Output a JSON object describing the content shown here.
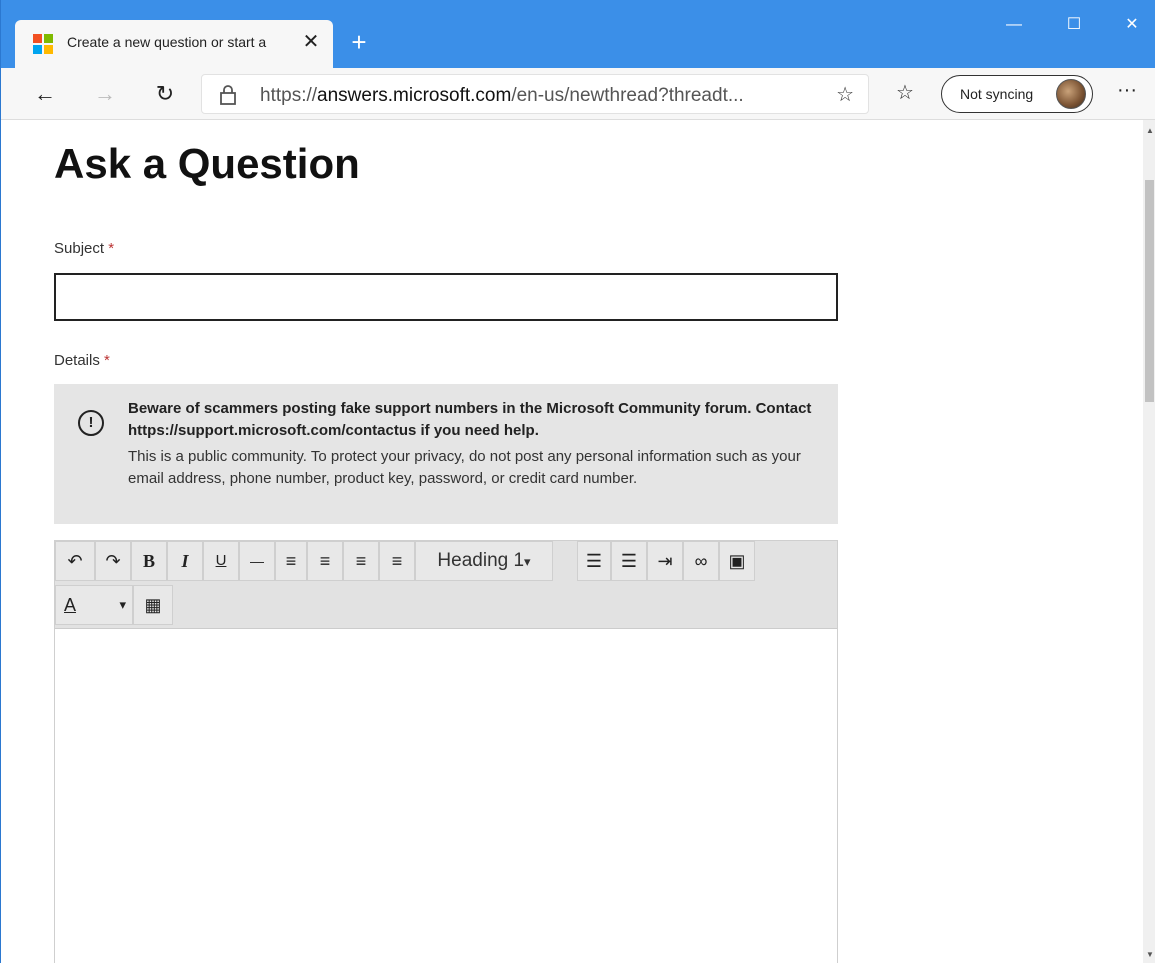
{
  "browser": {
    "tab_title": "Create a new question or start a",
    "tab_close": "✕",
    "new_tab": "+",
    "minimize": "—",
    "maximize": "☐",
    "close": "✕",
    "url_prefix": "https://",
    "url_domain": "answers.microsoft.com",
    "url_path": "/en-us/newthread?threadt...",
    "sync_label": "Not syncing",
    "more": "···"
  },
  "page": {
    "title": "Ask a Question",
    "subject_label": "Subject",
    "details_label": "Details",
    "required_mark": "*",
    "subject_value": "",
    "notice_bold": "Beware of scammers posting fake support numbers in the Microsoft Community forum. Contact https://support.microsoft.com/contactus if you need help.",
    "notice_text": "This is a public community. To protect your privacy, do not post any personal information such as your email address, phone number, product key, password, or credit card number."
  },
  "toolbar": {
    "undo": "↶",
    "redo": "↷",
    "bold": "B",
    "italic": "I",
    "underline": "U",
    "strike": "—",
    "align_left": "≡",
    "align_center": "≡",
    "align_right": "≡",
    "justify": "≡",
    "heading": "Heading 1",
    "heading_caret": "▾",
    "bullets": "☰",
    "numbered": "☰",
    "indent": "⇥",
    "link": "∞",
    "image": "▣",
    "font_color": "A",
    "font_color_caret": "▾",
    "table": "▦"
  },
  "colors": {
    "titlebar": "#3b8fe8",
    "notice_bg": "#e5e5e5",
    "required": "#b33333"
  }
}
